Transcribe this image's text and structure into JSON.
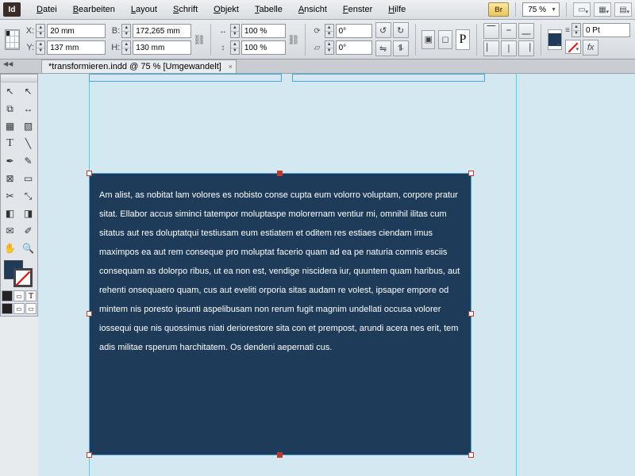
{
  "app": {
    "iconLabel": "Id"
  },
  "menu": {
    "datei": "Datei",
    "bearbeiten": "Bearbeiten",
    "layout": "Layout",
    "schrift": "Schrift",
    "objekt": "Objekt",
    "tabelle": "Tabelle",
    "ansicht": "Ansicht",
    "fenster": "Fenster",
    "hilfe": "Hilfe"
  },
  "menuRight": {
    "br": "Br",
    "zoom": "75 %"
  },
  "control": {
    "x": "20 mm",
    "y": "137 mm",
    "b": "172,265 mm",
    "h": "130 mm",
    "sx": "100 %",
    "sy": "100 %",
    "rot": "0°",
    "shear": "0°",
    "pt": "0 Pt",
    "charP": "P"
  },
  "docTab": {
    "title": "*transformieren.indd @ 75 % [Umgewandelt]"
  },
  "leftMarker": "◀◀",
  "textFrame": {
    "content": "Am alist, as nobitat lam volores es nobisto conse cupta eum volorro voluptam, corpore pratur sitat. Ellabor accus siminci tatempor moluptaspe molorernam ventiur mi, omnihil ilitas cum sitatus aut res doluptatqui testiusam eum estiatem et oditem res estiaes ciendam imus maximpos ea aut rem conseque pro moluptat facerio quam ad ea pe naturia comnis esciis consequam as dolorpo ribus, ut ea non est, vendige niscidera iur, quuntem quam haribus, aut rehenti onsequaero quam, cus aut eveliti orporia sitas audam re volest, ipsaper empore od mintem nis poresto ipsunti aspelibusam non rerum fugit magnim undellati occusa volorer iossequi que nis quossimus niati deriorestore sita con et prempost, arundi acera nes erit, tem adis militae rsperum harchitatem. Os dendeni aepernati cus."
  }
}
